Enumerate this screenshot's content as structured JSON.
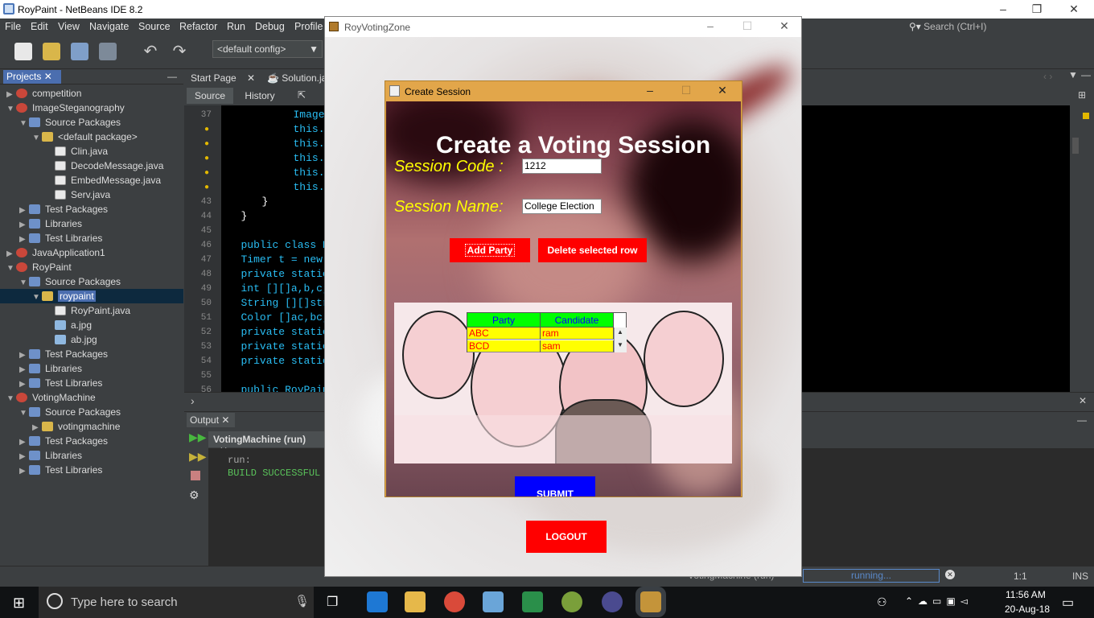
{
  "ide": {
    "title": "RoyPaint - NetBeans IDE 8.2",
    "menu": [
      "File",
      "Edit",
      "View",
      "Navigate",
      "Source",
      "Refactor",
      "Run",
      "Debug",
      "Profile"
    ],
    "config": "<default config>",
    "search_placeholder": "Search (Ctrl+I)",
    "projects_tab": "Projects",
    "tree": [
      {
        "label": "competition",
        "depth": 0,
        "icon": "cup",
        "arrow": "▶"
      },
      {
        "label": "ImageSteganography",
        "depth": 0,
        "icon": "cup",
        "arrow": "▼"
      },
      {
        "label": "Source Packages",
        "depth": 1,
        "icon": "sp",
        "arrow": "▼"
      },
      {
        "label": "<default package>",
        "depth": 2,
        "icon": "pk",
        "arrow": "▼"
      },
      {
        "label": "Clin.java",
        "depth": 3,
        "icon": "jf",
        "arrow": ""
      },
      {
        "label": "DecodeMessage.java",
        "depth": 3,
        "icon": "jf",
        "arrow": ""
      },
      {
        "label": "EmbedMessage.java",
        "depth": 3,
        "icon": "jf",
        "arrow": ""
      },
      {
        "label": "Serv.java",
        "depth": 3,
        "icon": "jf",
        "arrow": ""
      },
      {
        "label": "Test Packages",
        "depth": 1,
        "icon": "sp",
        "arrow": "▶"
      },
      {
        "label": "Libraries",
        "depth": 1,
        "icon": "sp",
        "arrow": "▶"
      },
      {
        "label": "Test Libraries",
        "depth": 1,
        "icon": "sp",
        "arrow": "▶"
      },
      {
        "label": "JavaApplication1",
        "depth": 0,
        "icon": "cup",
        "arrow": "▶"
      },
      {
        "label": "RoyPaint",
        "depth": 0,
        "icon": "cup",
        "arrow": "▼"
      },
      {
        "label": "Source Packages",
        "depth": 1,
        "icon": "sp",
        "arrow": "▼"
      },
      {
        "label": "roypaint",
        "depth": 2,
        "icon": "pk",
        "arrow": "▼",
        "selected": true
      },
      {
        "label": "RoyPaint.java",
        "depth": 3,
        "icon": "jf",
        "arrow": ""
      },
      {
        "label": "a.jpg",
        "depth": 3,
        "icon": "im",
        "arrow": ""
      },
      {
        "label": "ab.jpg",
        "depth": 3,
        "icon": "im",
        "arrow": ""
      },
      {
        "label": "Test Packages",
        "depth": 1,
        "icon": "sp",
        "arrow": "▶"
      },
      {
        "label": "Libraries",
        "depth": 1,
        "icon": "sp",
        "arrow": "▶"
      },
      {
        "label": "Test Libraries",
        "depth": 1,
        "icon": "sp",
        "arrow": "▶"
      },
      {
        "label": "VotingMachine",
        "depth": 0,
        "icon": "cup",
        "arrow": "▼"
      },
      {
        "label": "Source Packages",
        "depth": 1,
        "icon": "sp",
        "arrow": "▼"
      },
      {
        "label": "votingmachine",
        "depth": 2,
        "icon": "pk",
        "arrow": "▶"
      },
      {
        "label": "Test Packages",
        "depth": 1,
        "icon": "sp",
        "arrow": "▶"
      },
      {
        "label": "Libraries",
        "depth": 1,
        "icon": "sp",
        "arrow": "▶"
      },
      {
        "label": "Test Libraries",
        "depth": 1,
        "icon": "sp",
        "arrow": "▶"
      }
    ],
    "editor_tabs": [
      "Start Page",
      "Solution.ja"
    ],
    "source_btn": "Source",
    "history_btn": "History",
    "code_lines": [
      {
        "n": "37",
        "text": "ImageI",
        "cls": "kw",
        "indent": "           "
      },
      {
        "n": "",
        "text": "this.s",
        "cls": "kw",
        "indent": "           "
      },
      {
        "n": "",
        "text": "this.s",
        "cls": "kw",
        "indent": "           "
      },
      {
        "n": "",
        "text": "this.s",
        "cls": "kw",
        "indent": "           "
      },
      {
        "n": "",
        "text": "this.s",
        "cls": "kw",
        "indent": "           "
      },
      {
        "n": "",
        "text": "this.s",
        "cls": "kw",
        "indent": "           "
      },
      {
        "n": "43",
        "text": "}",
        "cls": "plain",
        "indent": "     "
      },
      {
        "n": "44",
        "text": "}",
        "cls": "plain",
        "indent": " "
      },
      {
        "n": "45",
        "text": "",
        "cls": "plain",
        "indent": ""
      },
      {
        "n": "46",
        "text": "public class R",
        "cls": "kw",
        "indent": " "
      },
      {
        "n": "47",
        "text": "Timer t = new",
        "cls": "kw",
        "indent": " "
      },
      {
        "n": "48",
        "text": "private static",
        "cls": "kw",
        "indent": " "
      },
      {
        "n": "49",
        "text": "int [][]a,b,c,",
        "cls": "kw",
        "indent": " "
      },
      {
        "n": "50",
        "text": "String [][]str",
        "cls": "kw",
        "indent": " "
      },
      {
        "n": "51",
        "text": "Color []ac,bc,",
        "cls": "kw",
        "indent": " "
      },
      {
        "n": "52",
        "text": "private static",
        "cls": "kw",
        "indent": " "
      },
      {
        "n": "53",
        "text": "private static",
        "cls": "kw",
        "indent": " "
      },
      {
        "n": "54",
        "text": "private static",
        "cls": "kw",
        "indent": " "
      },
      {
        "n": "55",
        "text": "",
        "cls": "plain",
        "indent": ""
      },
      {
        "n": "56",
        "text": "public RoyPain",
        "cls": "kw",
        "indent": " "
      }
    ],
    "output_tab": "Output",
    "output_subtab": "VotingMachine (run)",
    "output_run": "run:",
    "output_build": "BUILD SUCCESSFUL",
    "status_name": "VotingMachine (run)",
    "status_running": "running...",
    "status_pos": "1:1",
    "status_ins": "INS"
  },
  "rvz": {
    "title": "RoyVotingZone",
    "logout": "LOGOUT"
  },
  "dialog": {
    "title": "Create Session",
    "heading": "Create a Voting Session",
    "code_label": "Session Code :",
    "code_value": "1212",
    "name_label": "Session Name:",
    "name_value": "College Election",
    "add_party": "Add Party",
    "delete_row": "Delete selected row",
    "table_headers": [
      "Party",
      "Candidate"
    ],
    "table_rows": [
      [
        "ABC",
        "ram"
      ],
      [
        "BCD",
        "sam"
      ]
    ],
    "submit": "SUBMIT"
  },
  "taskbar": {
    "search_placeholder": "Type here to search",
    "time": "11:56 AM",
    "date": "20-Aug-18"
  }
}
